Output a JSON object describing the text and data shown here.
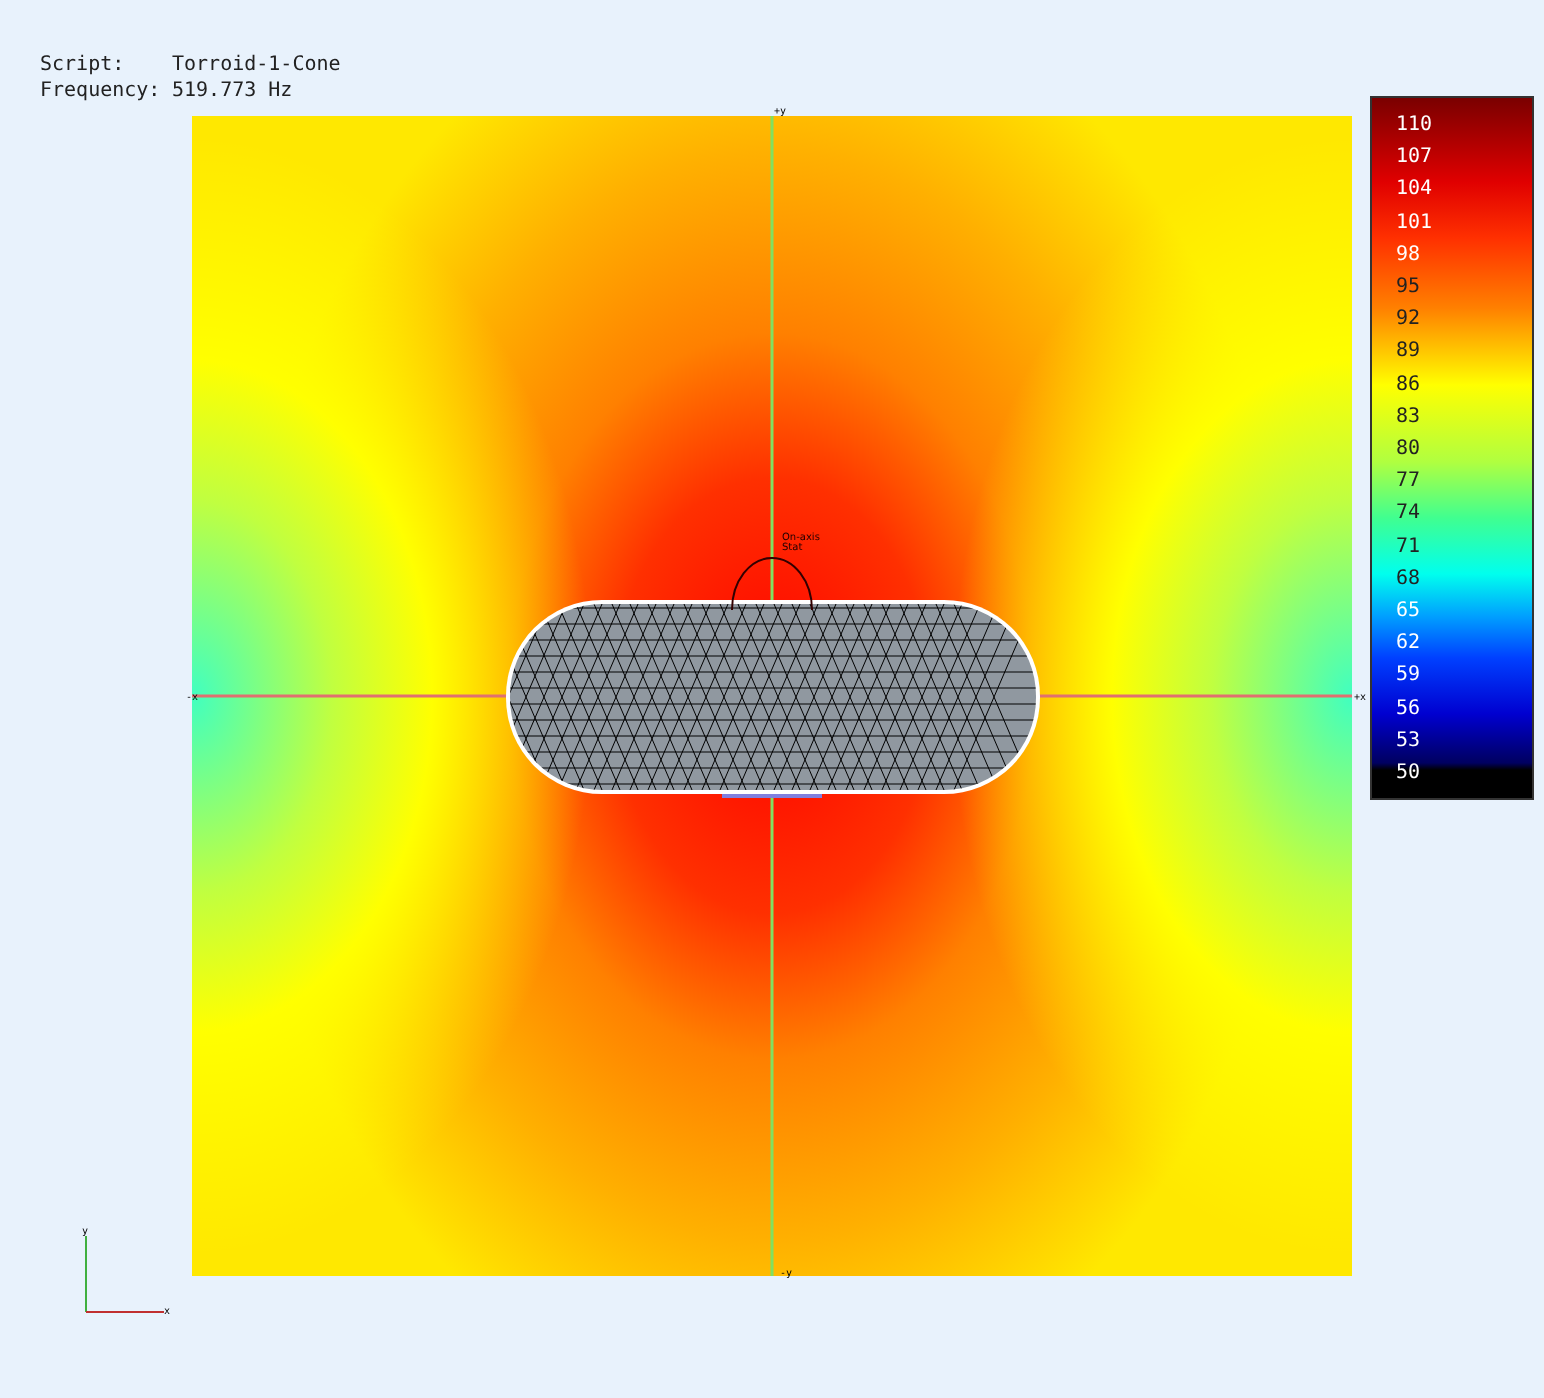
{
  "info": [
    {
      "label": "Script:",
      "value": "Torroid-1-Cone"
    },
    {
      "label": "Frequency:",
      "value": "519.773 Hz"
    }
  ],
  "plot": {
    "axis_labels": {
      "left": "-x",
      "right": "+x",
      "top": "+y",
      "bottom": "-y"
    },
    "probe_label": "On-axis\nStat"
  },
  "legend": {
    "labels": [
      "110",
      "107",
      "104",
      "101",
      "98",
      "95",
      "92",
      "89",
      "86",
      "83",
      "80",
      "77",
      "74",
      "71",
      "68",
      "65",
      "62",
      "59",
      "56",
      "53",
      "50"
    ]
  },
  "triad": {
    "x": "x",
    "y": "y"
  }
}
